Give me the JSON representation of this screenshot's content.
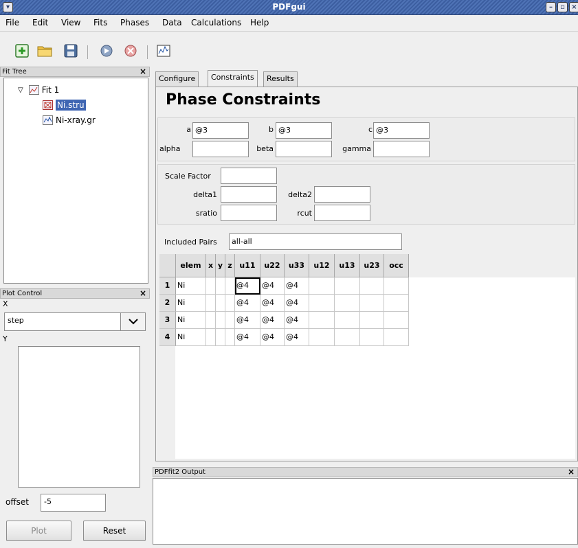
{
  "window": {
    "title": "PDFgui"
  },
  "menu": [
    "File",
    "Edit",
    "View",
    "Fits",
    "Phases",
    "Data",
    "Calculations",
    "Help"
  ],
  "fit_tree": {
    "header": "Fit Tree",
    "close": "×",
    "items": [
      {
        "label": "Fit 1"
      },
      {
        "label": "Ni.stru"
      },
      {
        "label": "Ni-xray.gr"
      }
    ]
  },
  "plot_control": {
    "header": "Plot Control",
    "close": "×",
    "x_label": "X",
    "x_value": "step",
    "y_label": "Y",
    "offset_label": "offset",
    "offset_value": "-5",
    "plot_button": "Plot",
    "reset_button": "Reset"
  },
  "tabs": [
    "Configure",
    "Constraints",
    "Results"
  ],
  "active_tab": "Constraints",
  "constraints": {
    "title": "Phase Constraints",
    "lattice": {
      "a_label": "a",
      "a_value": "@3",
      "b_label": "b",
      "b_value": "@3",
      "c_label": "c",
      "c_value": "@3",
      "alpha_label": "alpha",
      "alpha_value": "",
      "beta_label": "beta",
      "beta_value": "",
      "gamma_label": "gamma",
      "gamma_value": ""
    },
    "params": {
      "scale_label": "Scale Factor",
      "scale_value": "",
      "delta1_label": "delta1",
      "delta1_value": "",
      "delta2_label": "delta2",
      "delta2_value": "",
      "sratio_label": "sratio",
      "sratio_value": "",
      "rcut_label": "rcut",
      "rcut_value": ""
    },
    "included_pairs_label": "Included Pairs",
    "included_pairs_value": "all-all",
    "grid": {
      "columns": [
        "elem",
        "x",
        "y",
        "z",
        "u11",
        "u22",
        "u33",
        "u12",
        "u13",
        "u23",
        "occ"
      ],
      "rows": [
        {
          "num": "1",
          "cells": [
            "Ni",
            "",
            "",
            "",
            "@4",
            "@4",
            "@4",
            "",
            "",
            "",
            ""
          ]
        },
        {
          "num": "2",
          "cells": [
            "Ni",
            "",
            "",
            "",
            "@4",
            "@4",
            "@4",
            "",
            "",
            "",
            ""
          ]
        },
        {
          "num": "3",
          "cells": [
            "Ni",
            "",
            "",
            "",
            "@4",
            "@4",
            "@4",
            "",
            "",
            "",
            ""
          ]
        },
        {
          "num": "4",
          "cells": [
            "Ni",
            "",
            "",
            "",
            "@4",
            "@4",
            "@4",
            "",
            "",
            "",
            ""
          ]
        }
      ]
    }
  },
  "output": {
    "header": "PDFfit2 Output",
    "close": "×"
  }
}
